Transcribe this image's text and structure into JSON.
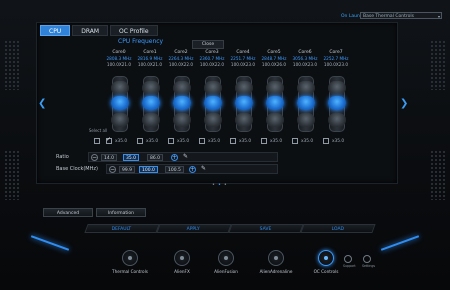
{
  "header": {
    "on_launch_label": "On Launch",
    "profile_select_value": "Base Thermal Controls"
  },
  "tabs": [
    {
      "label": "CPU",
      "active": true
    },
    {
      "label": "DRAM",
      "active": false
    },
    {
      "label": "OC Profile",
      "active": false
    }
  ],
  "panel": {
    "close_label": "Close",
    "frequency_title": "CPU Frequency",
    "select_all_label": "Select all"
  },
  "cores": [
    {
      "name": "Core0",
      "mhz": "2808.3 MHz",
      "ratio": "100.0X21.0",
      "knob": "mid",
      "checked": true,
      "mult": "x35.0"
    },
    {
      "name": "Core1",
      "mhz": "2816.9 MHz",
      "ratio": "100.0X21.0",
      "knob": "mid",
      "checked": false,
      "mult": "x35.0"
    },
    {
      "name": "Core2",
      "mhz": "2264.3 MHz",
      "ratio": "100.0X22.0",
      "knob": "mid",
      "checked": false,
      "mult": "x35.0"
    },
    {
      "name": "Core3",
      "mhz": "2360.7 MHz",
      "ratio": "100.0X22.0",
      "knob": "mid",
      "checked": false,
      "mult": "x35.0"
    },
    {
      "name": "Core4",
      "mhz": "2251.7 MHz",
      "ratio": "100.0X23.0",
      "knob": "mid",
      "checked": false,
      "mult": "x35.0"
    },
    {
      "name": "Core5",
      "mhz": "2848.7 MHz",
      "ratio": "100.0X26.0",
      "knob": "mid",
      "checked": false,
      "mult": "x35.0"
    },
    {
      "name": "Core6",
      "mhz": "3056.3 MHz",
      "ratio": "100.0X23.0",
      "knob": "mid",
      "checked": false,
      "mult": "x35.0"
    },
    {
      "name": "Core7",
      "mhz": "2252.7 MHz",
      "ratio": "100.0X23.0",
      "knob": "mid",
      "checked": false,
      "mult": "x35.0"
    }
  ],
  "ratio_row": {
    "label": "Ratio",
    "min": "14.0",
    "current": "35.0",
    "max": "86.0",
    "minus": "−",
    "plus": "+"
  },
  "bclk_row": {
    "label": "Base Clock(MHz)",
    "min": "99.9",
    "current": "100.0",
    "max": "100.5",
    "minus": "−",
    "plus": "+"
  },
  "buttons": {
    "advanced": "Advanced",
    "information": "Information"
  },
  "actions": [
    "DEFAULT",
    "APPLY",
    "SAVE",
    "LOAD"
  ],
  "bottom_nav": [
    {
      "label": "Thermal Controls",
      "active": false
    },
    {
      "label": "AlienFX",
      "active": false
    },
    {
      "label": "AlienFusion",
      "active": false
    },
    {
      "label": "AlienAdrenaline",
      "active": false
    },
    {
      "label": "OC Controls",
      "active": true
    }
  ],
  "small_icons": [
    {
      "label": "Support"
    },
    {
      "label": "Settings"
    }
  ],
  "colors": {
    "accent": "#2f8cf0",
    "background": "#0b0d10"
  }
}
